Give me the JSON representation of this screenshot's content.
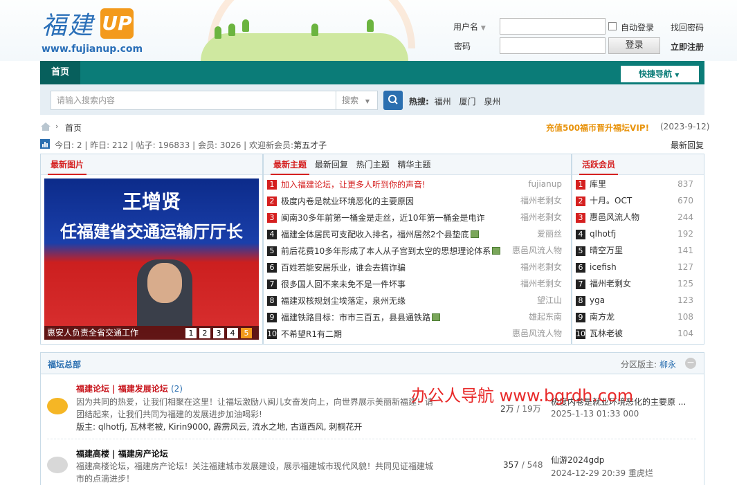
{
  "header": {
    "logo_text": "福建",
    "logo_up": "UP",
    "site_url": "www.fujianup.com",
    "username_label": "用户名",
    "password_label": "密码",
    "auto_login": "自动登录",
    "find_password": "找回密码",
    "login_button": "登录",
    "register": "立即注册"
  },
  "nav": {
    "home": "首页",
    "quick_nav": "快捷导航"
  },
  "search": {
    "placeholder": "请输入搜索内容",
    "scope": "搜索",
    "hot_label": "热搜:",
    "hot_terms": [
      "福州",
      "厦门",
      "泉州"
    ]
  },
  "breadcrumb": {
    "home": "首页",
    "promo": "充值500福币晋升福坛VIP!",
    "promo_date": "(2023-9-12)"
  },
  "stats": {
    "today": "今日: 2",
    "yesterday": "昨日: 212",
    "posts": "帖子: 196833",
    "members": "会员: 3026",
    "welcome": "欢迎新会员:",
    "new_member": "第五才子",
    "latest_reply": "最新回复"
  },
  "latest_images": {
    "title": "最新图片",
    "headline_1": "王增贤",
    "headline_2": "任福建省交通运输厅厅长",
    "caption": "惠安人负责全省交通工作",
    "pages": [
      "1",
      "2",
      "3",
      "4",
      "5"
    ]
  },
  "topics": {
    "tabs": [
      "最新主题",
      "最新回复",
      "热门主题",
      "精华主题"
    ],
    "items": [
      {
        "n": "1",
        "title": "加入福建论坛，让更多人听到你的声音!",
        "author": "fujianup",
        "hot": true
      },
      {
        "n": "2",
        "title": "极度内卷是就业环境恶化的主要原因",
        "author": "福州老剩女",
        "hot": true
      },
      {
        "n": "3",
        "title": "闽南30多年前第一桶金是走丝，近10年第一桶金是电诈",
        "author": "福州老剩女",
        "hot": true
      },
      {
        "n": "4",
        "title": "福建全体居民可支配收入排名，福州居然2个县垫底",
        "author": "爱丽丝",
        "hot": false
      },
      {
        "n": "5",
        "title": "前后花费10多年形成了本人从子宫到太空的思想理论体系",
        "author": "惠邑风流人物",
        "hot": false
      },
      {
        "n": "6",
        "title": "百姓若能安居乐业，谁会去搞诈骗",
        "author": "福州老剩女",
        "hot": false
      },
      {
        "n": "7",
        "title": "很多国人回不来未免不是一件坏事",
        "author": "福州老剩女",
        "hot": false
      },
      {
        "n": "8",
        "title": "福建双核规划尘埃落定，泉州无缘",
        "author": "望江山",
        "hot": false
      },
      {
        "n": "9",
        "title": "福建铁路目标：市市三百五，县县通铁路",
        "author": "雄起东南",
        "hot": false
      },
      {
        "n": "10",
        "title": "不希望R1有二期",
        "author": "惠邑风流人物",
        "hot": false
      }
    ]
  },
  "active_members": {
    "title": "活跃会员",
    "items": [
      {
        "n": "1",
        "name": "库里",
        "score": "837",
        "hot": true
      },
      {
        "n": "2",
        "name": "十月。OCT",
        "score": "670",
        "hot": true
      },
      {
        "n": "3",
        "name": "惠邑风流人物",
        "score": "244",
        "hot": true
      },
      {
        "n": "4",
        "name": "qlhotfj",
        "score": "192",
        "hot": false
      },
      {
        "n": "5",
        "name": "晴空万里",
        "score": "141",
        "hot": false
      },
      {
        "n": "6",
        "name": "icefish",
        "score": "127",
        "hot": false
      },
      {
        "n": "7",
        "name": "福州老剩女",
        "score": "125",
        "hot": false
      },
      {
        "n": "8",
        "name": "yga",
        "score": "123",
        "hot": false
      },
      {
        "n": "9",
        "name": "南方龙",
        "score": "108",
        "hot": false
      },
      {
        "n": "10",
        "name": "瓦林老被",
        "score": "104",
        "hot": false
      }
    ]
  },
  "forum": {
    "title": "福坛总部",
    "moderator_label": "分区版主:",
    "moderator": "柳永",
    "boards": [
      {
        "name": "福建论坛 | 福建发展论坛",
        "count": "(2)",
        "desc_1": "因为共同的热爱，让我们相聚在这里！让福坛激励八闽儿女奋发向上，向世界展示美丽新福建！请",
        "desc_2": "团结起来，让我们共同为福建的发展进步加油喝彩!",
        "mods": "版主: qlhotfj, 瓦林老被, Kirin9000, 霹雳风云, 流水之地, 古道西风, 刺桐花开",
        "stats_a": "2万",
        "stats_b": "19万",
        "last_title": "极度内卷是就业环境恶化的主要原 ...",
        "last_time": "2025-1-13 01:33 000"
      },
      {
        "name": "福建高楼 | 福建房产论坛",
        "desc_1": "福建高楼论坛，福建房产论坛！关注福建城市发展建设，展示福建城市现代风貌！共同见证福建城",
        "desc_2": "市的点滴进步！",
        "stats_a": "357",
        "stats_b": "548",
        "last_title": "仙游2024gdp",
        "last_time": "2024-12-29 20:39 重虎烂"
      }
    ]
  },
  "watermark": "办公人导航 www.bgrdh.com",
  "colors": {
    "nav": "#0b7c78",
    "accent_red": "#d52020",
    "promo": "#e8930c",
    "link_blue": "#2b6fb0"
  }
}
